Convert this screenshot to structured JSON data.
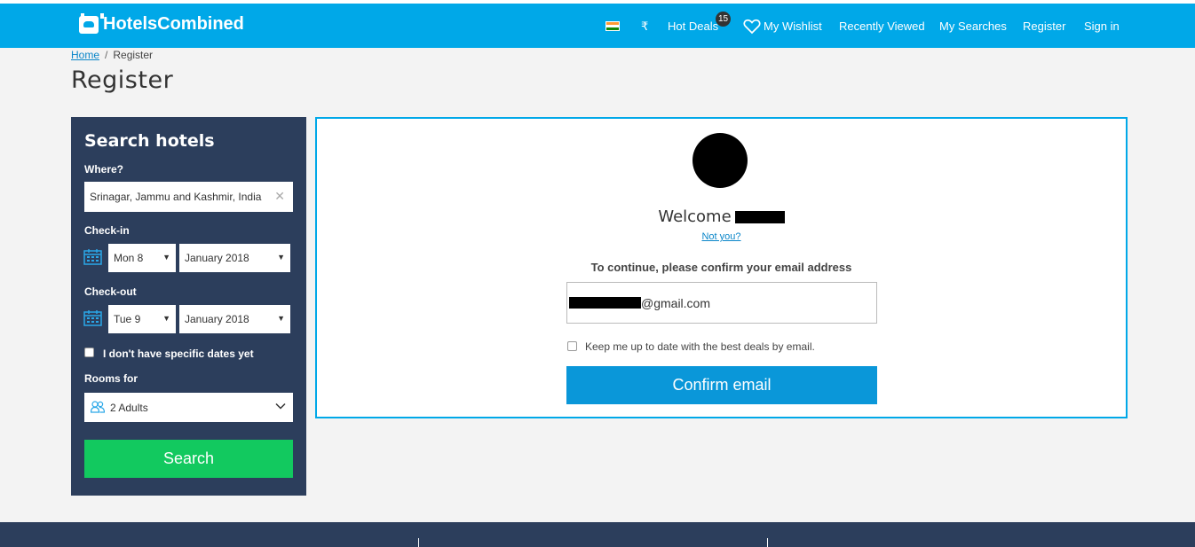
{
  "header": {
    "logo_text": "HotelsCombined",
    "currency": "₹",
    "nav": {
      "hot_deals": "Hot Deals",
      "hot_deals_count": "15",
      "wishlist": "My Wishlist",
      "recently_viewed": "Recently Viewed",
      "my_searches": "My Searches",
      "register": "Register",
      "sign_in": "Sign in"
    }
  },
  "breadcrumb": {
    "home": "Home",
    "separator": "/",
    "current": "Register"
  },
  "page_title": "Register",
  "search": {
    "title": "Search hotels",
    "where_label": "Where?",
    "where_value": "Srinagar, Jammu and Kashmir, India",
    "checkin_label": "Check-in",
    "checkin_day": "Mon 8",
    "checkin_month": "January 2018",
    "checkout_label": "Check-out",
    "checkout_day": "Tue 9",
    "checkout_month": "January 2018",
    "no_dates_label": "I don't have specific dates yet",
    "rooms_label": "Rooms for",
    "rooms_value": "2 Adults",
    "search_button": "Search"
  },
  "confirm": {
    "welcome": "Welcome",
    "not_you": "Not you?",
    "instruction": "To continue, please confirm your email address",
    "email_suffix": "@gmail.com",
    "keep_updated": "Keep me up to date with the best deals by email.",
    "confirm_button": "Confirm email"
  },
  "colors": {
    "header": "#00a8e8",
    "panel": "#2c3e5c",
    "search_button": "#12c95f",
    "confirm_button": "#0a97d9"
  }
}
